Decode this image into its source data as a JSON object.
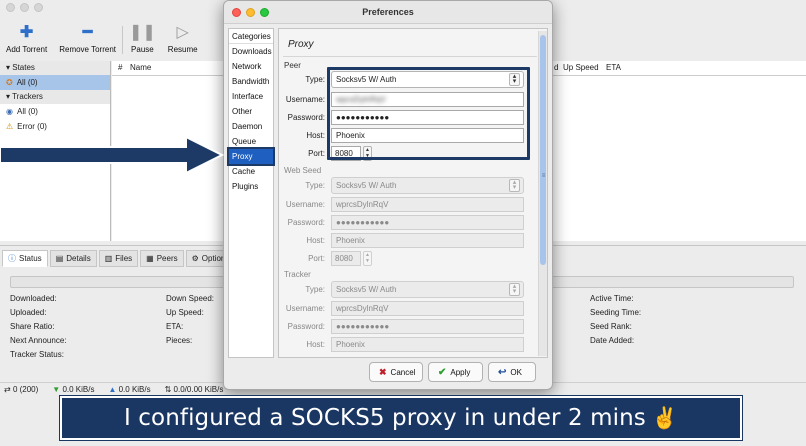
{
  "app": {
    "toolbar": [
      {
        "label": "Add Torrent",
        "icon": "plus-icon"
      },
      {
        "label": "Remove Torrent",
        "icon": "minus-icon"
      },
      {
        "label": "Pause",
        "icon": "pause-icon"
      },
      {
        "label": "Resume",
        "icon": "play-icon"
      }
    ],
    "sidebar": {
      "states_header": "States",
      "states_all": "All (0)",
      "trackers_header": "Trackers",
      "trackers_all": "All (0)",
      "trackers_error": "Error (0)"
    },
    "list_columns": {
      "hash": "#",
      "name": "Name",
      "partial_col": "d",
      "up_speed": "Up Speed",
      "eta": "ETA"
    },
    "tabs": [
      {
        "label": "Status",
        "icon": "info-icon"
      },
      {
        "label": "Details",
        "icon": "details-icon"
      },
      {
        "label": "Files",
        "icon": "files-icon"
      },
      {
        "label": "Peers",
        "icon": "peers-icon"
      },
      {
        "label": "Options",
        "icon": "options-icon"
      }
    ],
    "status_fields": {
      "downloaded": "Downloaded:",
      "uploaded": "Uploaded:",
      "share_ratio": "Share Ratio:",
      "next_announce": "Next Announce:",
      "tracker_status": "Tracker Status:",
      "down_speed": "Down Speed:",
      "up_speed": "Up Speed:",
      "eta": "ETA:",
      "pieces": "Pieces:",
      "active_time": "Active Time:",
      "seeding_time": "Seeding Time:",
      "seed_rank": "Seed Rank:",
      "date_added": "Date Added:"
    },
    "statusbar": {
      "connections": "0 (200)",
      "down": "0.0 KiB/s",
      "up": "0.0 KiB/s",
      "dht": "0.0/0.00 KiB/s"
    }
  },
  "prefs": {
    "title": "Preferences",
    "categories_header": "Categories",
    "categories": [
      "Downloads",
      "Network",
      "Bandwidth",
      "Interface",
      "Other",
      "Daemon",
      "Queue",
      "Proxy",
      "Cache",
      "Plugins"
    ],
    "selected_category": "Proxy",
    "pane_title": "Proxy",
    "peer": {
      "label": "Peer",
      "type_label": "Type:",
      "type_value": "Socksv5 W/ Auth",
      "username_label": "Username:",
      "username_value": "wpcsDylnRqV",
      "password_label": "Password:",
      "password_value": "●●●●●●●●●●●",
      "host_label": "Host:",
      "host_value": "Phoenix",
      "port_label": "Port:",
      "port_value": "8080"
    },
    "web_seed": {
      "label": "Web Seed",
      "type_label": "Type:",
      "type_value": "Socksv5 W/ Auth",
      "username_label": "Username:",
      "username_value": "wprcsDylnRqV",
      "password_label": "Password:",
      "password_value": "●●●●●●●●●●●",
      "host_label": "Host:",
      "host_value": "Phoenix",
      "port_label": "Port:",
      "port_value": "8080"
    },
    "tracker": {
      "label": "Tracker",
      "type_label": "Type:",
      "type_value": "Socksv5 W/ Auth",
      "username_label": "Username:",
      "username_value": "wprcsDylnRqV",
      "password_label": "Password:",
      "password_value": "●●●●●●●●●●●",
      "host_label": "Host:",
      "host_value": "Phoenix"
    },
    "buttons": {
      "cancel": "Cancel",
      "apply": "Apply",
      "ok": "OK"
    }
  },
  "caption": {
    "text": "I configured a SOCKS5 proxy in under 2 mins",
    "emoji": "✌️"
  },
  "colors": {
    "banner": "#1a3663",
    "arrow": "#1d3a66",
    "selected_category": "#1f5fbf"
  }
}
